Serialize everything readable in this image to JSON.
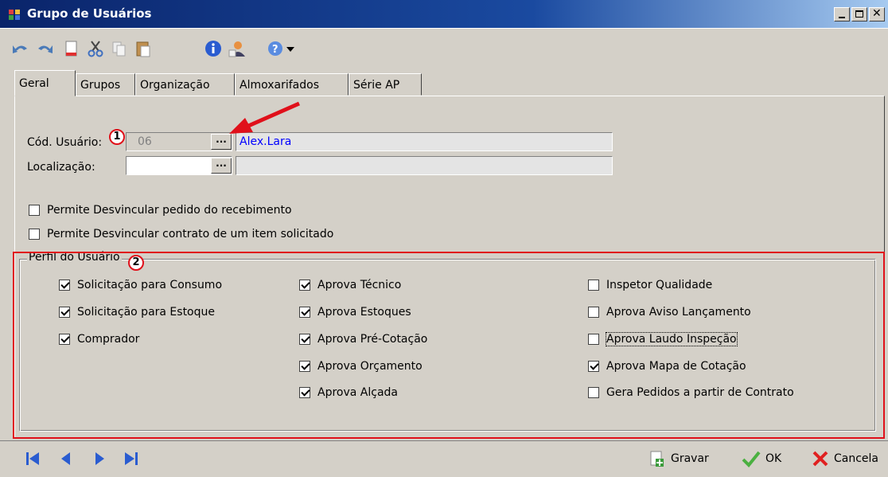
{
  "window": {
    "title": "Grupo de Usuários"
  },
  "tabs": [
    {
      "label": "Geral"
    },
    {
      "label": "Grupos"
    },
    {
      "label": "Organização"
    },
    {
      "label": "Almoxarifados"
    },
    {
      "label": "Série AP"
    }
  ],
  "form": {
    "cod_usuario_label": "Cód. Usuário:",
    "cod_usuario_value": "06",
    "usuario_name": "Alex.Lara",
    "localizacao_label": "Localização:",
    "localizacao_value": "",
    "ellipsis": "...",
    "permite_recebimento": "Permite Desvincular pedido do recebimento",
    "permite_contrato": "Permite Desvincular contrato de um item solicitado"
  },
  "perfil": {
    "title": "Perfil do Usuário",
    "col1": [
      {
        "label": "Solicitação para Consumo",
        "checked": true
      },
      {
        "label": "Solicitação para Estoque",
        "checked": true
      },
      {
        "label": "Comprador",
        "checked": true
      }
    ],
    "col2": [
      {
        "label": "Aprova Técnico",
        "checked": true
      },
      {
        "label": "Aprova Estoques",
        "checked": true
      },
      {
        "label": "Aprova Pré-Cotação",
        "checked": true
      },
      {
        "label": "Aprova Orçamento",
        "checked": true
      },
      {
        "label": "Aprova Alçada",
        "checked": true
      }
    ],
    "col3": [
      {
        "label": "Inspetor Qualidade",
        "checked": false
      },
      {
        "label": "Aprova Aviso Lançamento",
        "checked": false
      },
      {
        "label": "Aprova Laudo Inspeção",
        "checked": false
      },
      {
        "label": "Aprova Mapa de Cotação",
        "checked": true
      },
      {
        "label": "Gera Pedidos a partir de Contrato",
        "checked": false
      }
    ]
  },
  "annotations": {
    "one": "1",
    "two": "2"
  },
  "actions": {
    "gravar": "Gravar",
    "ok": "OK",
    "cancela": "Cancela"
  },
  "colors": {
    "annotation_red": "#e0101a",
    "title_blue": "#0a246a",
    "link_blue": "#0000ff"
  }
}
